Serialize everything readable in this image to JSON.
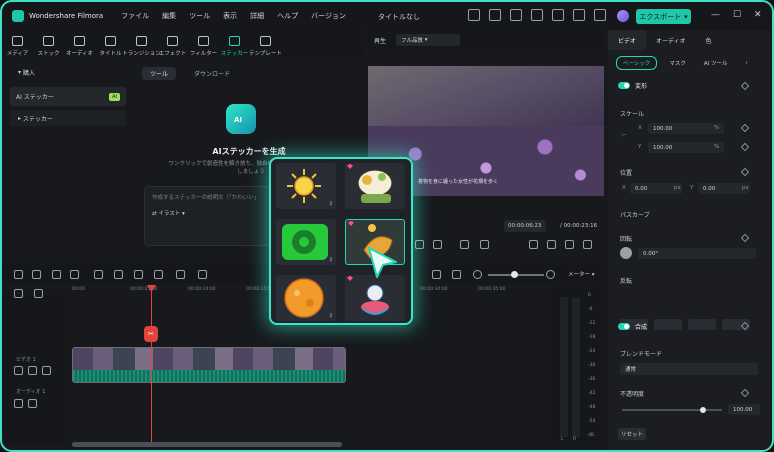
{
  "titlebar": {
    "app_name": "Wondershare Filmora",
    "menu": [
      "ファイル",
      "編集",
      "ツール",
      "表示",
      "詳細",
      "ヘルプ",
      "バージョン"
    ],
    "doc_title": "タイトルなし",
    "export_label": "エクスポート"
  },
  "toolbar": {
    "tools": [
      "メディア",
      "ストック",
      "オーディオ",
      "タイトル",
      "トランジション",
      "エフェクト",
      "フィルター",
      "ステッカー",
      "テンプレート"
    ]
  },
  "left_panel": {
    "import": "購入",
    "ai_sticker": "AI ステッカー",
    "ai_badge": "AI",
    "sticker": "ステッカー"
  },
  "media": {
    "tabs": [
      "ツール",
      "ダウンロード"
    ],
    "ai_face_label": "AI",
    "title": "AIステッカーを生成",
    "desc": "ワンクリックで創造性を解き放ち、独自のステッカーを今すぐ作成しましょう",
    "prompt_placeholder": "作成するステッカーの説明文（「かわいい」",
    "style_label": "イラスト"
  },
  "preview": {
    "label": "再生",
    "quality": "フル品質",
    "subtitle": "着物を身に纏った女性が花畑を歩く",
    "time_current": "00:00:06:23",
    "time_total": "/ 00:00:23:16"
  },
  "right_panel": {
    "tabs": [
      "ビデオ",
      "オーディオ",
      "色"
    ],
    "subtabs": [
      "ベーシック",
      "マスク",
      "AI ツール"
    ],
    "transform": "変形",
    "scale": "スケール",
    "x_label": "X",
    "y_label": "Y",
    "scale_x": "100.00",
    "scale_y": "100.00",
    "percent": "%",
    "position": "位置",
    "pos_x": "0.00",
    "pos_y": "0.00",
    "px": "px",
    "path_curve": "パスカーブ",
    "rotate": "回転",
    "rotate_value": "0.00°",
    "flip": "反転",
    "composite": "合成",
    "blend_mode": "ブレンドモード",
    "blend_value": "通常",
    "opacity": "不透明度",
    "opacity_value": "100.00",
    "reset": "リセット"
  },
  "timeline": {
    "meter_label": "メーター",
    "ruler": [
      "00:00",
      "00:00:05:00",
      "00:00:10:00",
      "00:00:15:00",
      "00:00:20:00",
      "00:00:25:00",
      "00:00:30:00",
      "00:00:35:00"
    ],
    "video_track": "ビデオ 1",
    "audio_track": "オーディオ 1",
    "db_marks": [
      "0",
      "-6",
      "-12",
      "-18",
      "-24",
      "-30",
      "-36",
      "-42",
      "-48",
      "-54",
      "dB"
    ],
    "meter_lr": [
      "L",
      "R"
    ]
  },
  "popup": {
    "stickers": [
      {
        "name": "sun",
        "downloaded": true
      },
      {
        "name": "mushroom-character",
        "premium": true
      },
      {
        "name": "green-donut",
        "downloaded": true
      },
      {
        "name": "croissant",
        "premium": true,
        "selected": true
      },
      {
        "name": "orange-planet",
        "downloaded": true
      },
      {
        "name": "astronaut-fish",
        "premium": true
      }
    ],
    "accent": "#37e7c7"
  },
  "colors": {
    "accent": "#25d6b8",
    "playhead": "#e0453b",
    "frame_border": "#3fe3c4"
  }
}
